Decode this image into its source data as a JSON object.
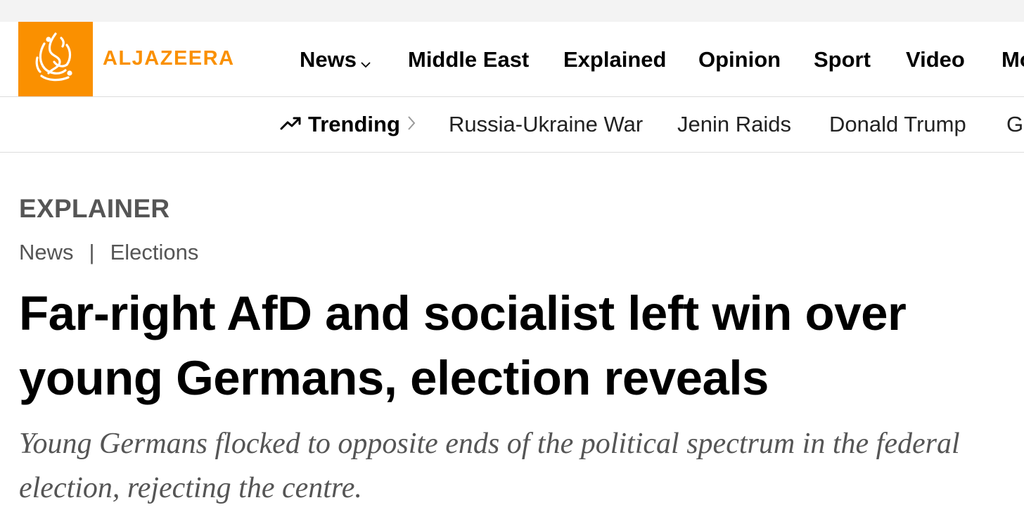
{
  "brand": {
    "name": "ALJAZEERA",
    "color": "#fa9000"
  },
  "main_nav": {
    "items": [
      {
        "label": "News",
        "has_dropdown": true
      },
      {
        "label": "Middle East"
      },
      {
        "label": "Explained"
      },
      {
        "label": "Opinion"
      },
      {
        "label": "Sport"
      },
      {
        "label": "Video"
      },
      {
        "label": "Mo"
      }
    ]
  },
  "trending": {
    "label": "Trending",
    "icon": "trending-up-icon",
    "topics": [
      "Russia-Ukraine War",
      "Jenin Raids",
      "Donald Trump",
      "Ga"
    ]
  },
  "article": {
    "kicker": "EXPLAINER",
    "breadcrumbs": [
      "News",
      "Elections"
    ],
    "breadcrumb_separator": "|",
    "headline": "Far-right AfD and socialist left win over young Germans, election reveals",
    "dek": "Young Germans flocked to opposite ends of the political spectrum in the federal election, rejecting the centre."
  }
}
